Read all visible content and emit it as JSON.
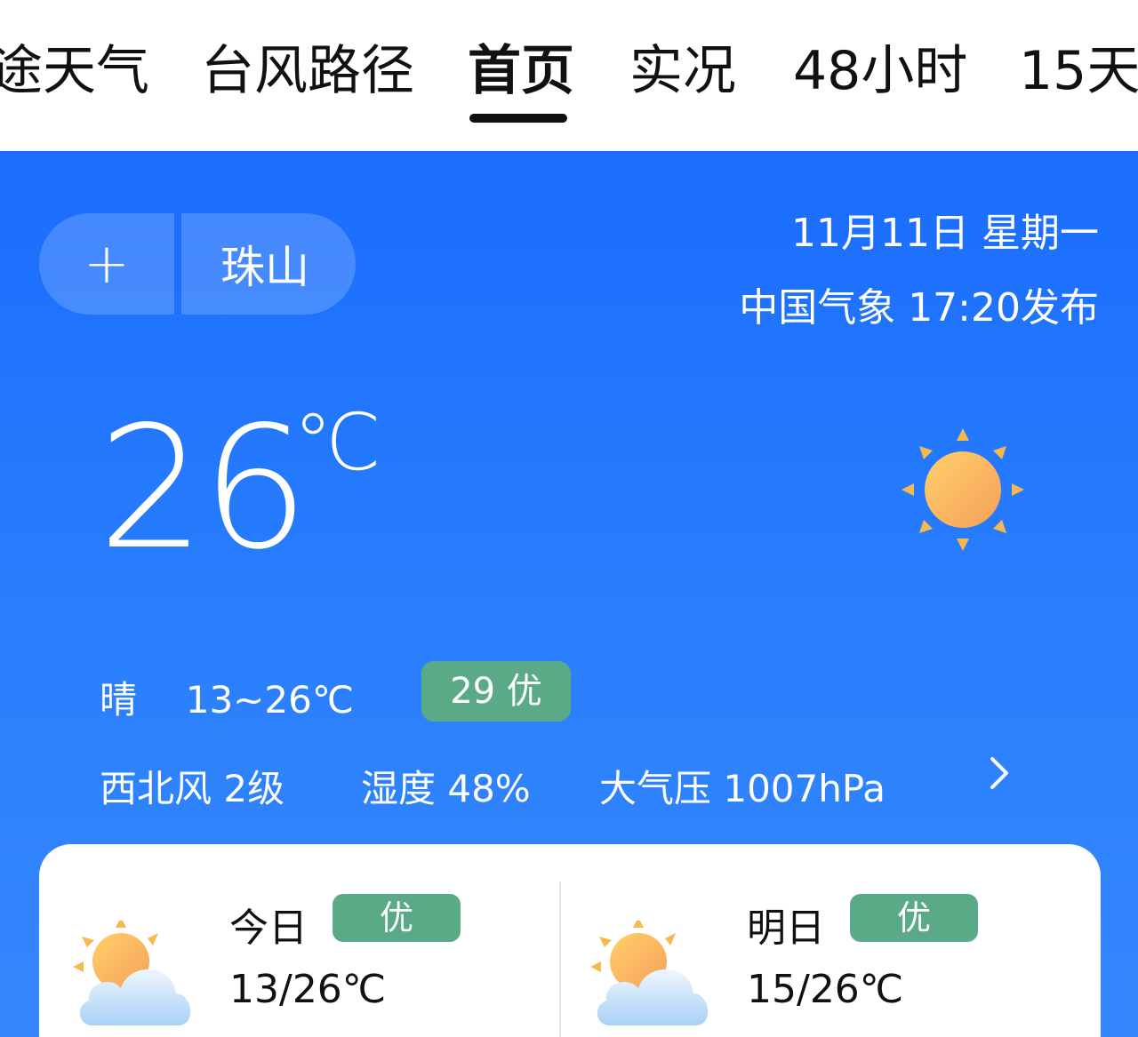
{
  "nav": {
    "tabs": [
      {
        "label": "途天气"
      },
      {
        "label": "台风路径"
      },
      {
        "label": "首页"
      },
      {
        "label": "实况"
      },
      {
        "label": "48小时"
      },
      {
        "label": "15天"
      }
    ],
    "active": "首页"
  },
  "header": {
    "add_label": "+",
    "city": "珠山",
    "date": "11月11日 星期一",
    "publisher": "中国气象  17:20发布"
  },
  "current": {
    "temp": "26",
    "unit": "℃",
    "icon": "sun-icon",
    "condition": "晴",
    "range": "13~26℃",
    "aqi": "29 优",
    "aqi_color": "#5aaa88",
    "wind": "西北风 2级",
    "humidity": "湿度 48%",
    "pressure": "大气压 1007hPa"
  },
  "forecast": [
    {
      "day": "今日",
      "quality": "优",
      "temp": "13/26℃",
      "icon": "partly-cloudy-icon"
    },
    {
      "day": "明日",
      "quality": "优",
      "temp": "15/26℃",
      "icon": "partly-cloudy-icon"
    }
  ],
  "colors": {
    "accent": "#1a6dfd",
    "badge": "#5aaa88",
    "sun": "#f7a93b"
  }
}
